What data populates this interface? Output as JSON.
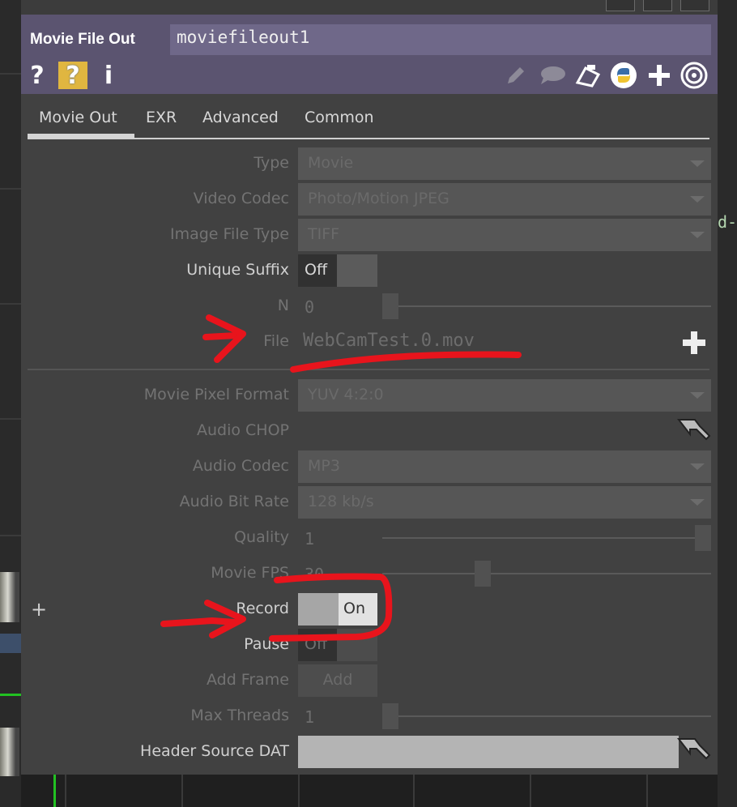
{
  "background": {
    "side_text": "d-"
  },
  "header": {
    "operator_type": "Movie File Out",
    "operator_name": "moviefileout1",
    "left_icons": [
      "help-icon",
      "python-help-icon",
      "info-icon"
    ],
    "right_icons": [
      "edit-icon",
      "comment-icon",
      "clipboard-icon",
      "python-icon",
      "add-icon",
      "viewer-icon"
    ]
  },
  "tabs": [
    {
      "label": "Movie Out",
      "active": true
    },
    {
      "label": "EXR",
      "active": false
    },
    {
      "label": "Advanced",
      "active": false
    },
    {
      "label": "Common",
      "active": false
    }
  ],
  "params": {
    "type": {
      "label": "Type",
      "value": "Movie"
    },
    "video_codec": {
      "label": "Video Codec",
      "value": "Photo/Motion JPEG"
    },
    "image_file_type": {
      "label": "Image File Type",
      "value": "TIFF"
    },
    "unique_suffix": {
      "label": "Unique Suffix",
      "value": "Off"
    },
    "n": {
      "label": "N",
      "value": "0"
    },
    "file": {
      "label": "File",
      "value": "WebCamTest.0.mov"
    },
    "movie_pixel_format": {
      "label": "Movie Pixel Format",
      "value": "YUV 4:2:0"
    },
    "audio_chop": {
      "label": "Audio CHOP"
    },
    "audio_codec": {
      "label": "Audio Codec",
      "value": "MP3"
    },
    "audio_bit_rate": {
      "label": "Audio Bit Rate",
      "value": "128 kb/s"
    },
    "quality": {
      "label": "Quality",
      "value": "1"
    },
    "movie_fps": {
      "label": "Movie FPS",
      "value": "30"
    },
    "record": {
      "label": "Record",
      "value": "On"
    },
    "pause": {
      "label": "Pause",
      "value": "Off"
    },
    "add_frame": {
      "label": "Add Frame",
      "button": "Add"
    },
    "max_threads": {
      "label": "Max Threads",
      "value": "1"
    },
    "header_source_dat": {
      "label": "Header Source DAT"
    }
  },
  "annotation_color": "#e8141c"
}
